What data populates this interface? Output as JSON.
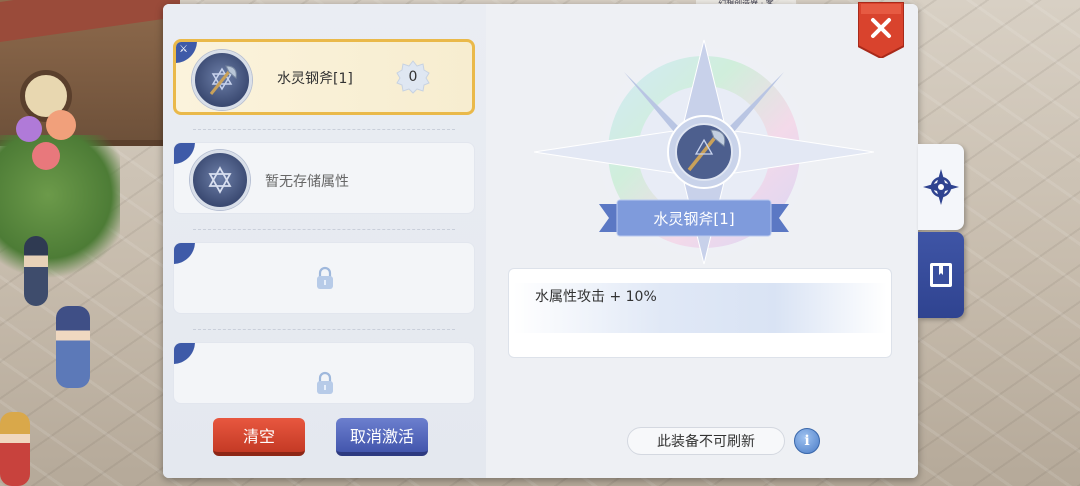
{
  "top_label": "幻想创造器 · 客",
  "slots": [
    {
      "name": "水灵钢斧[1]",
      "count": "0",
      "state": "active"
    },
    {
      "name": "暂无存储属性",
      "state": "empty"
    },
    {
      "state": "locked"
    },
    {
      "state": "locked"
    }
  ],
  "buttons": {
    "clear": "清空",
    "cancel_activate": "取消激活"
  },
  "item": {
    "name": "水灵钢斧[1]",
    "attribute": "水属性攻击 + 10%"
  },
  "note": "此装备不可刷新",
  "icons": {
    "info": "i",
    "close": "close-icon",
    "compass": "compass-icon",
    "book": "book-icon",
    "lock": "lock-icon",
    "axe": "axe-icon",
    "star": "hexagram-icon"
  },
  "colors": {
    "accent_blue": "#3e5aa8",
    "active_border": "#eab94a",
    "red_button": "#c43a25",
    "blue_button": "#4356ad"
  }
}
